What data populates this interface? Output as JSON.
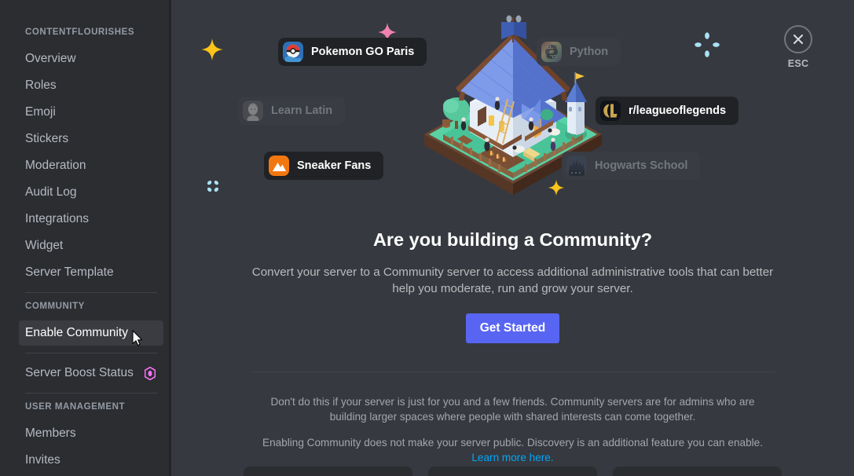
{
  "sidebar": {
    "sections": [
      {
        "header": "CONTENTFLOURISHES",
        "items": [
          {
            "label": "Overview",
            "name": "overview"
          },
          {
            "label": "Roles",
            "name": "roles"
          },
          {
            "label": "Emoji",
            "name": "emoji"
          },
          {
            "label": "Stickers",
            "name": "stickers"
          },
          {
            "label": "Moderation",
            "name": "moderation"
          },
          {
            "label": "Audit Log",
            "name": "audit-log"
          },
          {
            "label": "Integrations",
            "name": "integrations"
          },
          {
            "label": "Widget",
            "name": "widget"
          },
          {
            "label": "Server Template",
            "name": "server-template"
          }
        ]
      },
      {
        "header": "COMMUNITY",
        "items": [
          {
            "label": "Enable Community",
            "name": "enable-community",
            "active": true
          },
          {
            "label": "Server Boost Status",
            "name": "server-boost-status",
            "badge": "boost-gem"
          }
        ]
      },
      {
        "header": "USER MANAGEMENT",
        "items": [
          {
            "label": "Members",
            "name": "members"
          },
          {
            "label": "Invites",
            "name": "invites"
          }
        ]
      }
    ]
  },
  "close": {
    "icon": "close-icon",
    "label": "ESC"
  },
  "illustration": {
    "scene": "isometric-village",
    "chips": [
      {
        "id": "pokemon",
        "label": "Pokemon GO Paris",
        "icon": "pokeball-icon",
        "dim": false
      },
      {
        "id": "latin",
        "label": "Learn Latin",
        "icon": "roman-statue-icon",
        "dim": true
      },
      {
        "id": "sneaker",
        "label": "Sneaker Fans",
        "icon": "sneaker-peak-icon",
        "dim": false
      },
      {
        "id": "python",
        "label": "Python",
        "icon": "python-logo-icon",
        "dim": true
      },
      {
        "id": "lol",
        "label": "r/leagueoflegends",
        "icon": "league-legends-icon",
        "dim": false
      },
      {
        "id": "hogwarts",
        "label": "Hogwarts School",
        "icon": "hogwarts-castle-icon",
        "dim": true
      }
    ],
    "decorations": [
      {
        "id": "spark-yellow-1",
        "icon": "sparkle-star-icon",
        "color": "#fcc419"
      },
      {
        "id": "spark-pink",
        "icon": "sparkle-star-icon",
        "color": "#f082ae"
      },
      {
        "id": "spark-blue-1",
        "icon": "sparkle-dots-icon",
        "color": "#a8e2f5"
      },
      {
        "id": "spark-blue-2",
        "icon": "sparkle-dots-icon",
        "color": "#a8e2f5"
      },
      {
        "id": "spark-yellow-2",
        "icon": "sparkle-star-icon",
        "color": "#fcc419"
      }
    ]
  },
  "main": {
    "headline": "Are you building a Community?",
    "subtext": "Convert your server to a Community server to access additional administrative tools that can better help you moderate, run and grow your server.",
    "cta_label": "Get Started",
    "footnote_1": "Don't do this if your server is just for you and a few friends. Community servers are for admins who are building larger spaces where people with shared interests can come together.",
    "footnote_2_text": "Enabling Community does not make your server public. Discovery is an additional feature you can enable. ",
    "footnote_2_link": "Learn more here."
  },
  "colors": {
    "sidebar_bg": "#2b2d31",
    "main_bg": "#36393f",
    "accent_blurple": "#5865f2",
    "link_blue": "#00a8fc",
    "boost_pink": "#ff73fa",
    "active_item_bg": "#3a3c42"
  }
}
